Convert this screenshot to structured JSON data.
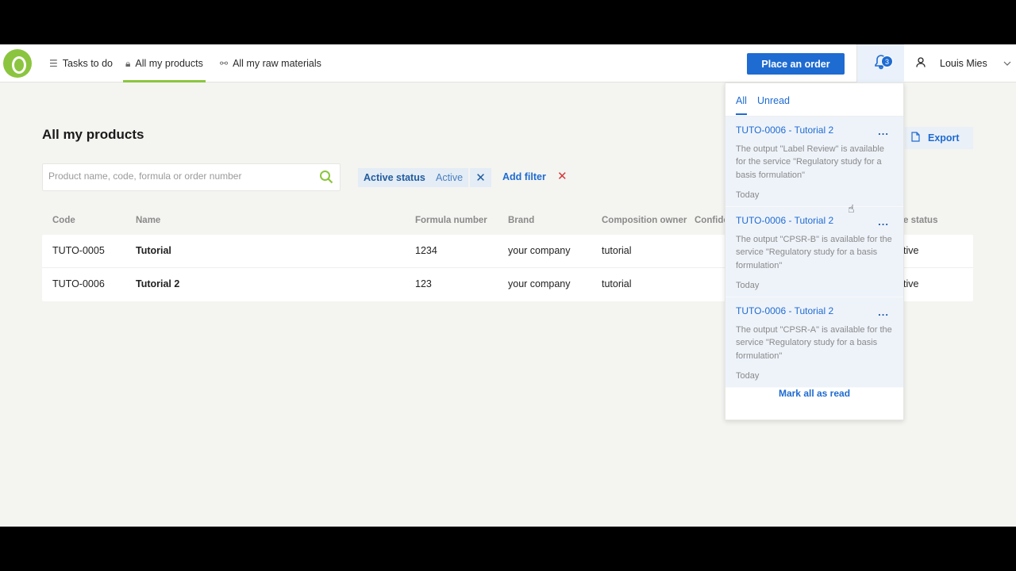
{
  "nav": {
    "items": [
      {
        "label": "Tasks to do",
        "icon": "task-list-icon"
      },
      {
        "label": "All my products",
        "icon": "lock-icon"
      },
      {
        "label": "All my raw materials",
        "icon": "raw-materials-icon"
      }
    ],
    "order_button": "Place an order",
    "notification_count": "3",
    "user_name": "Louis Mies"
  },
  "main": {
    "title": "All my products",
    "search_placeholder": "Product name, code, formula or order number",
    "filter": {
      "key": "Active status",
      "value": "Active"
    },
    "add_filter": "Add filter",
    "export": "Export",
    "columns": [
      "Code",
      "Name",
      "Formula number",
      "Brand",
      "Composition owner",
      "Confide",
      "e status"
    ],
    "rows": [
      {
        "code": "TUTO-0005",
        "name": "Tutorial",
        "formula": "1234",
        "brand": "your company",
        "owner": "tutorial",
        "status": "tive"
      },
      {
        "code": "TUTO-0006",
        "name": "Tutorial 2",
        "formula": "123",
        "brand": "your company",
        "owner": "tutorial",
        "status": "tive"
      }
    ]
  },
  "notifications": {
    "tabs": [
      "All",
      "Unread"
    ],
    "items": [
      {
        "title": "TUTO-0006 - Tutorial 2",
        "more": "...",
        "body": "The output \"Label Review\" is available for the service \"Regulatory study for a basis formulation\"",
        "time": "Today"
      },
      {
        "title": "TUTO-0006 - Tutorial 2",
        "more": "...",
        "body": "The output \"CPSR-B\" is available for the service \"Regulatory study for a basis formulation\"",
        "time": "Today"
      },
      {
        "title": "TUTO-0006 - Tutorial 2",
        "more": "...",
        "body": "The output \"CPSR-A\" is available for the service \"Regulatory study for a basis formulation\"",
        "time": "Today"
      }
    ],
    "mark_all": "Mark all as read"
  },
  "colors": {
    "accent": "#1e6bd1",
    "brand": "#8bc53f",
    "danger": "#d23a3a"
  }
}
